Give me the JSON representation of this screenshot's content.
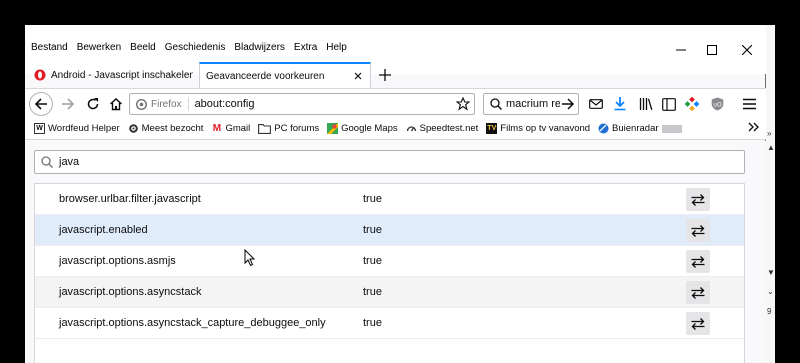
{
  "menu": [
    "Bestand",
    "Bewerken",
    "Beeld",
    "Geschiedenis",
    "Bladwijzers",
    "Extra",
    "Help"
  ],
  "tabs": [
    {
      "title": "Android - Javascript inschakelen"
    },
    {
      "title": "Geavanceerde voorkeuren"
    }
  ],
  "urlbar": {
    "identity": "Firefox",
    "url": "about:config"
  },
  "searchbar": {
    "value": "macrium reflect"
  },
  "bookmarks": [
    {
      "label": "Wordfeud Helper",
      "icon": "wordfeud-icon"
    },
    {
      "label": "Meest bezocht",
      "icon": "gear-icon"
    },
    {
      "label": "Gmail",
      "icon": "gmail-icon"
    },
    {
      "label": "PC forums",
      "icon": "folder-icon"
    },
    {
      "label": "Google Maps",
      "icon": "maps-icon"
    },
    {
      "label": "Speedtest.net",
      "icon": "speedometer-icon"
    },
    {
      "label": "Films op tv vanavond",
      "icon": "tv-icon"
    },
    {
      "label": "Buienradar",
      "icon": "buienradar-icon"
    }
  ],
  "filter": {
    "value": "java"
  },
  "prefs": [
    {
      "name": "browser.urlbar.filter.javascript",
      "value": "true"
    },
    {
      "name": "javascript.enabled",
      "value": "true"
    },
    {
      "name": "javascript.options.asmjs",
      "value": "true"
    },
    {
      "name": "javascript.options.asyncstack",
      "value": "true"
    },
    {
      "name": "javascript.options.asyncstack_capture_debuggee_only",
      "value": "true"
    }
  ],
  "colors": {
    "accent": "#0a84ff",
    "row_hover": "#e1ecfb",
    "tab_favicon": "#e01b24"
  }
}
